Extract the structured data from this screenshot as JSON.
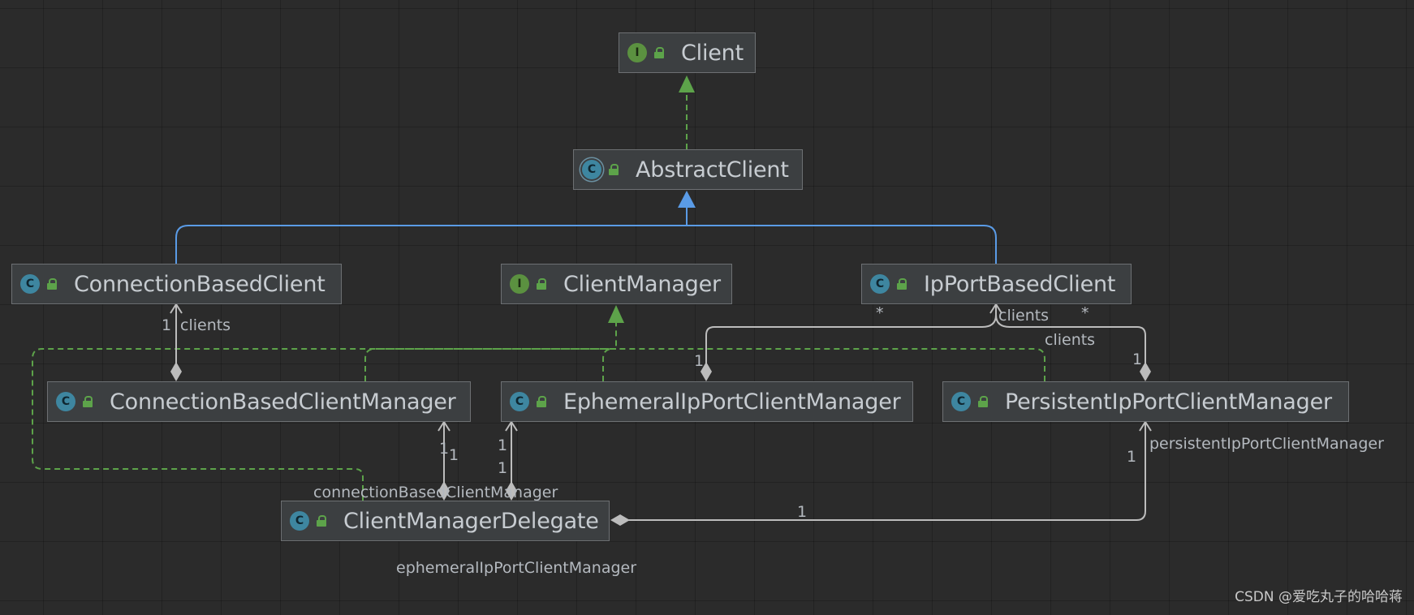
{
  "nodes": {
    "client": {
      "name": "Client",
      "kind": "I"
    },
    "abstract_client": {
      "name": "AbstractClient",
      "kind": "C"
    },
    "connection_based_client": {
      "name": "ConnectionBasedClient",
      "kind": "C"
    },
    "client_manager": {
      "name": "ClientManager",
      "kind": "I"
    },
    "ip_port_based_client": {
      "name": "IpPortBasedClient",
      "kind": "C"
    },
    "connection_based_client_manager": {
      "name": "ConnectionBasedClientManager",
      "kind": "C"
    },
    "ephemeral_ip_port_client_manager": {
      "name": "EphemeralIpPortClientManager",
      "kind": "C"
    },
    "persistent_ip_port_client_manager": {
      "name": "PersistentIpPortClientManager",
      "kind": "C"
    },
    "client_manager_delegate": {
      "name": "ClientManagerDelegate",
      "kind": "C"
    }
  },
  "annotations": {
    "cbcm_multiplicity": "1",
    "cbcm_role": "clients",
    "eph_multiplicity": "1",
    "ipport_star_left": "*",
    "ipport_role_top": "clients",
    "ipport_star_right": "*",
    "persistent_role": "clients",
    "persistent_multiplicity": "1",
    "delegate_cbcm_mult_a": "1",
    "delegate_cbcm_mult_b": "1",
    "delegate_eph_mult_a": "1",
    "delegate_eph_mult_b": "1",
    "delegate_persistent_role": "persistentIpPortClientManager",
    "delegate_persistent_mult": "1",
    "delegate_line_mult": "1",
    "delegate_cbcm_role": "connectionBasedClientManager",
    "delegate_eph_role": "ephemeralIpPortClientManager"
  },
  "watermark": "CSDN @爱吃丸子的哈哈蒋",
  "colors": {
    "background": "#2b2b2b",
    "node_fill": "#3c3f41",
    "node_border": "#6d7073",
    "implements": "#5da34a",
    "extends": "#5a9be6",
    "association": "#bcbcbc",
    "text": "#c7ccd1"
  }
}
